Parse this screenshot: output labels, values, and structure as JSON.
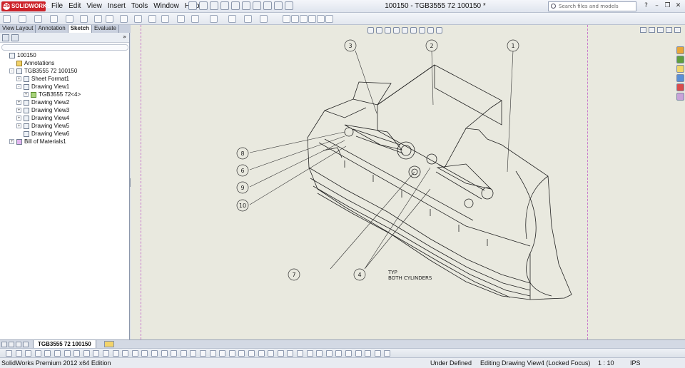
{
  "app": {
    "logo_text": "SOLIDWORKS",
    "document_title": "100150 - TGB3555 72 100150 *"
  },
  "menu": [
    "File",
    "Edit",
    "View",
    "Insert",
    "Tools",
    "Window",
    "Help"
  ],
  "search": {
    "placeholder": "Search files and models"
  },
  "tabs": [
    {
      "label": "View Layout",
      "active": false
    },
    {
      "label": "Annotation",
      "active": false
    },
    {
      "label": "Sketch",
      "active": true
    },
    {
      "label": "Evaluate",
      "active": false
    }
  ],
  "tree": [
    {
      "label": "100150",
      "icon": "drawing-icon",
      "level": 0,
      "expander": ""
    },
    {
      "label": "Annotations",
      "icon": "annotations-icon",
      "level": 1,
      "expander": ""
    },
    {
      "label": "TGB3555 72 100150",
      "icon": "sheet-icon",
      "level": 1,
      "expander": "-"
    },
    {
      "label": "Sheet Format1",
      "icon": "sheet-format-icon",
      "level": 2,
      "expander": "+"
    },
    {
      "label": "Drawing View1",
      "icon": "drawing-view-icon",
      "level": 2,
      "expander": "-"
    },
    {
      "label": "TGB3555 72<4>",
      "icon": "part-icon",
      "level": 3,
      "expander": "+"
    },
    {
      "label": "Drawing View2",
      "icon": "drawing-view-icon",
      "level": 2,
      "expander": "+"
    },
    {
      "label": "Drawing View3",
      "icon": "drawing-view-icon",
      "level": 2,
      "expander": "+"
    },
    {
      "label": "Drawing View4",
      "icon": "drawing-view-icon",
      "level": 2,
      "expander": "+"
    },
    {
      "label": "Drawing View5",
      "icon": "drawing-view-icon",
      "level": 2,
      "expander": "+"
    },
    {
      "label": "Drawing View6",
      "icon": "drawing-view-icon",
      "level": 2,
      "expander": ""
    },
    {
      "label": "Bill of Materials1",
      "icon": "bom-icon",
      "level": 1,
      "expander": "+"
    }
  ],
  "drawing": {
    "balloons": [
      "3",
      "2",
      "1",
      "8",
      "6",
      "9",
      "10",
      "7",
      "4"
    ],
    "note_line1": "TYP",
    "note_line2": "BOTH CYLINDERS"
  },
  "sheet_tab": "TGB3555 72 100150",
  "status": {
    "edition": "SolidWorks Premium 2012 x64 Edition",
    "definition": "Under Defined",
    "editing": "Editing Drawing View4 (Locked Focus)",
    "scale": "1 : 10",
    "units": "IPS"
  }
}
